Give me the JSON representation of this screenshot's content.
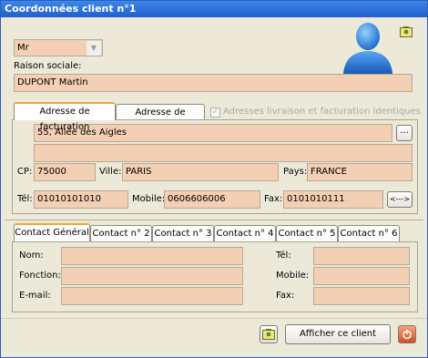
{
  "window": {
    "title": "Coordonnées client n°1"
  },
  "client": {
    "civilite": "Mr",
    "raison_sociale_label": "Raison sociale:",
    "raison_sociale": "DUPONT Martin"
  },
  "address_tabs": {
    "billing": "Adresse de facturation",
    "delivery": "Adresse de livraison",
    "identical_label": "Adresses livraison et facturation identiques"
  },
  "address": {
    "line1": "55, Allée des Aigles",
    "line2": "",
    "more_button": "...",
    "cp_label": "CP:",
    "cp": "75000",
    "ville_label": "Ville:",
    "ville": "PARIS",
    "pays_label": "Pays:",
    "pays": "FRANCE",
    "tel_label": "Tél:",
    "tel": "01010101010",
    "mobile_label": "Mobile:",
    "mobile": "0606606006",
    "fax_label": "Fax:",
    "fax": "0101010111",
    "swap_button": "<--->"
  },
  "contact_tabs": [
    "Contact Général",
    "Contact n° 2",
    "Contact n° 3",
    "Contact n° 4",
    "Contact n° 5",
    "Contact n° 6"
  ],
  "contact": {
    "nom_label": "Nom:",
    "fonction_label": "Fonction:",
    "email_label": "E-mail:",
    "tel_label": "Tél:",
    "mobile_label": "Mobile:",
    "fax_label": "Fax:",
    "nom": "",
    "fonction": "",
    "email": "",
    "tel": "",
    "mobile": "",
    "fax": ""
  },
  "footer": {
    "show_client_button": "Afficher ce client"
  }
}
